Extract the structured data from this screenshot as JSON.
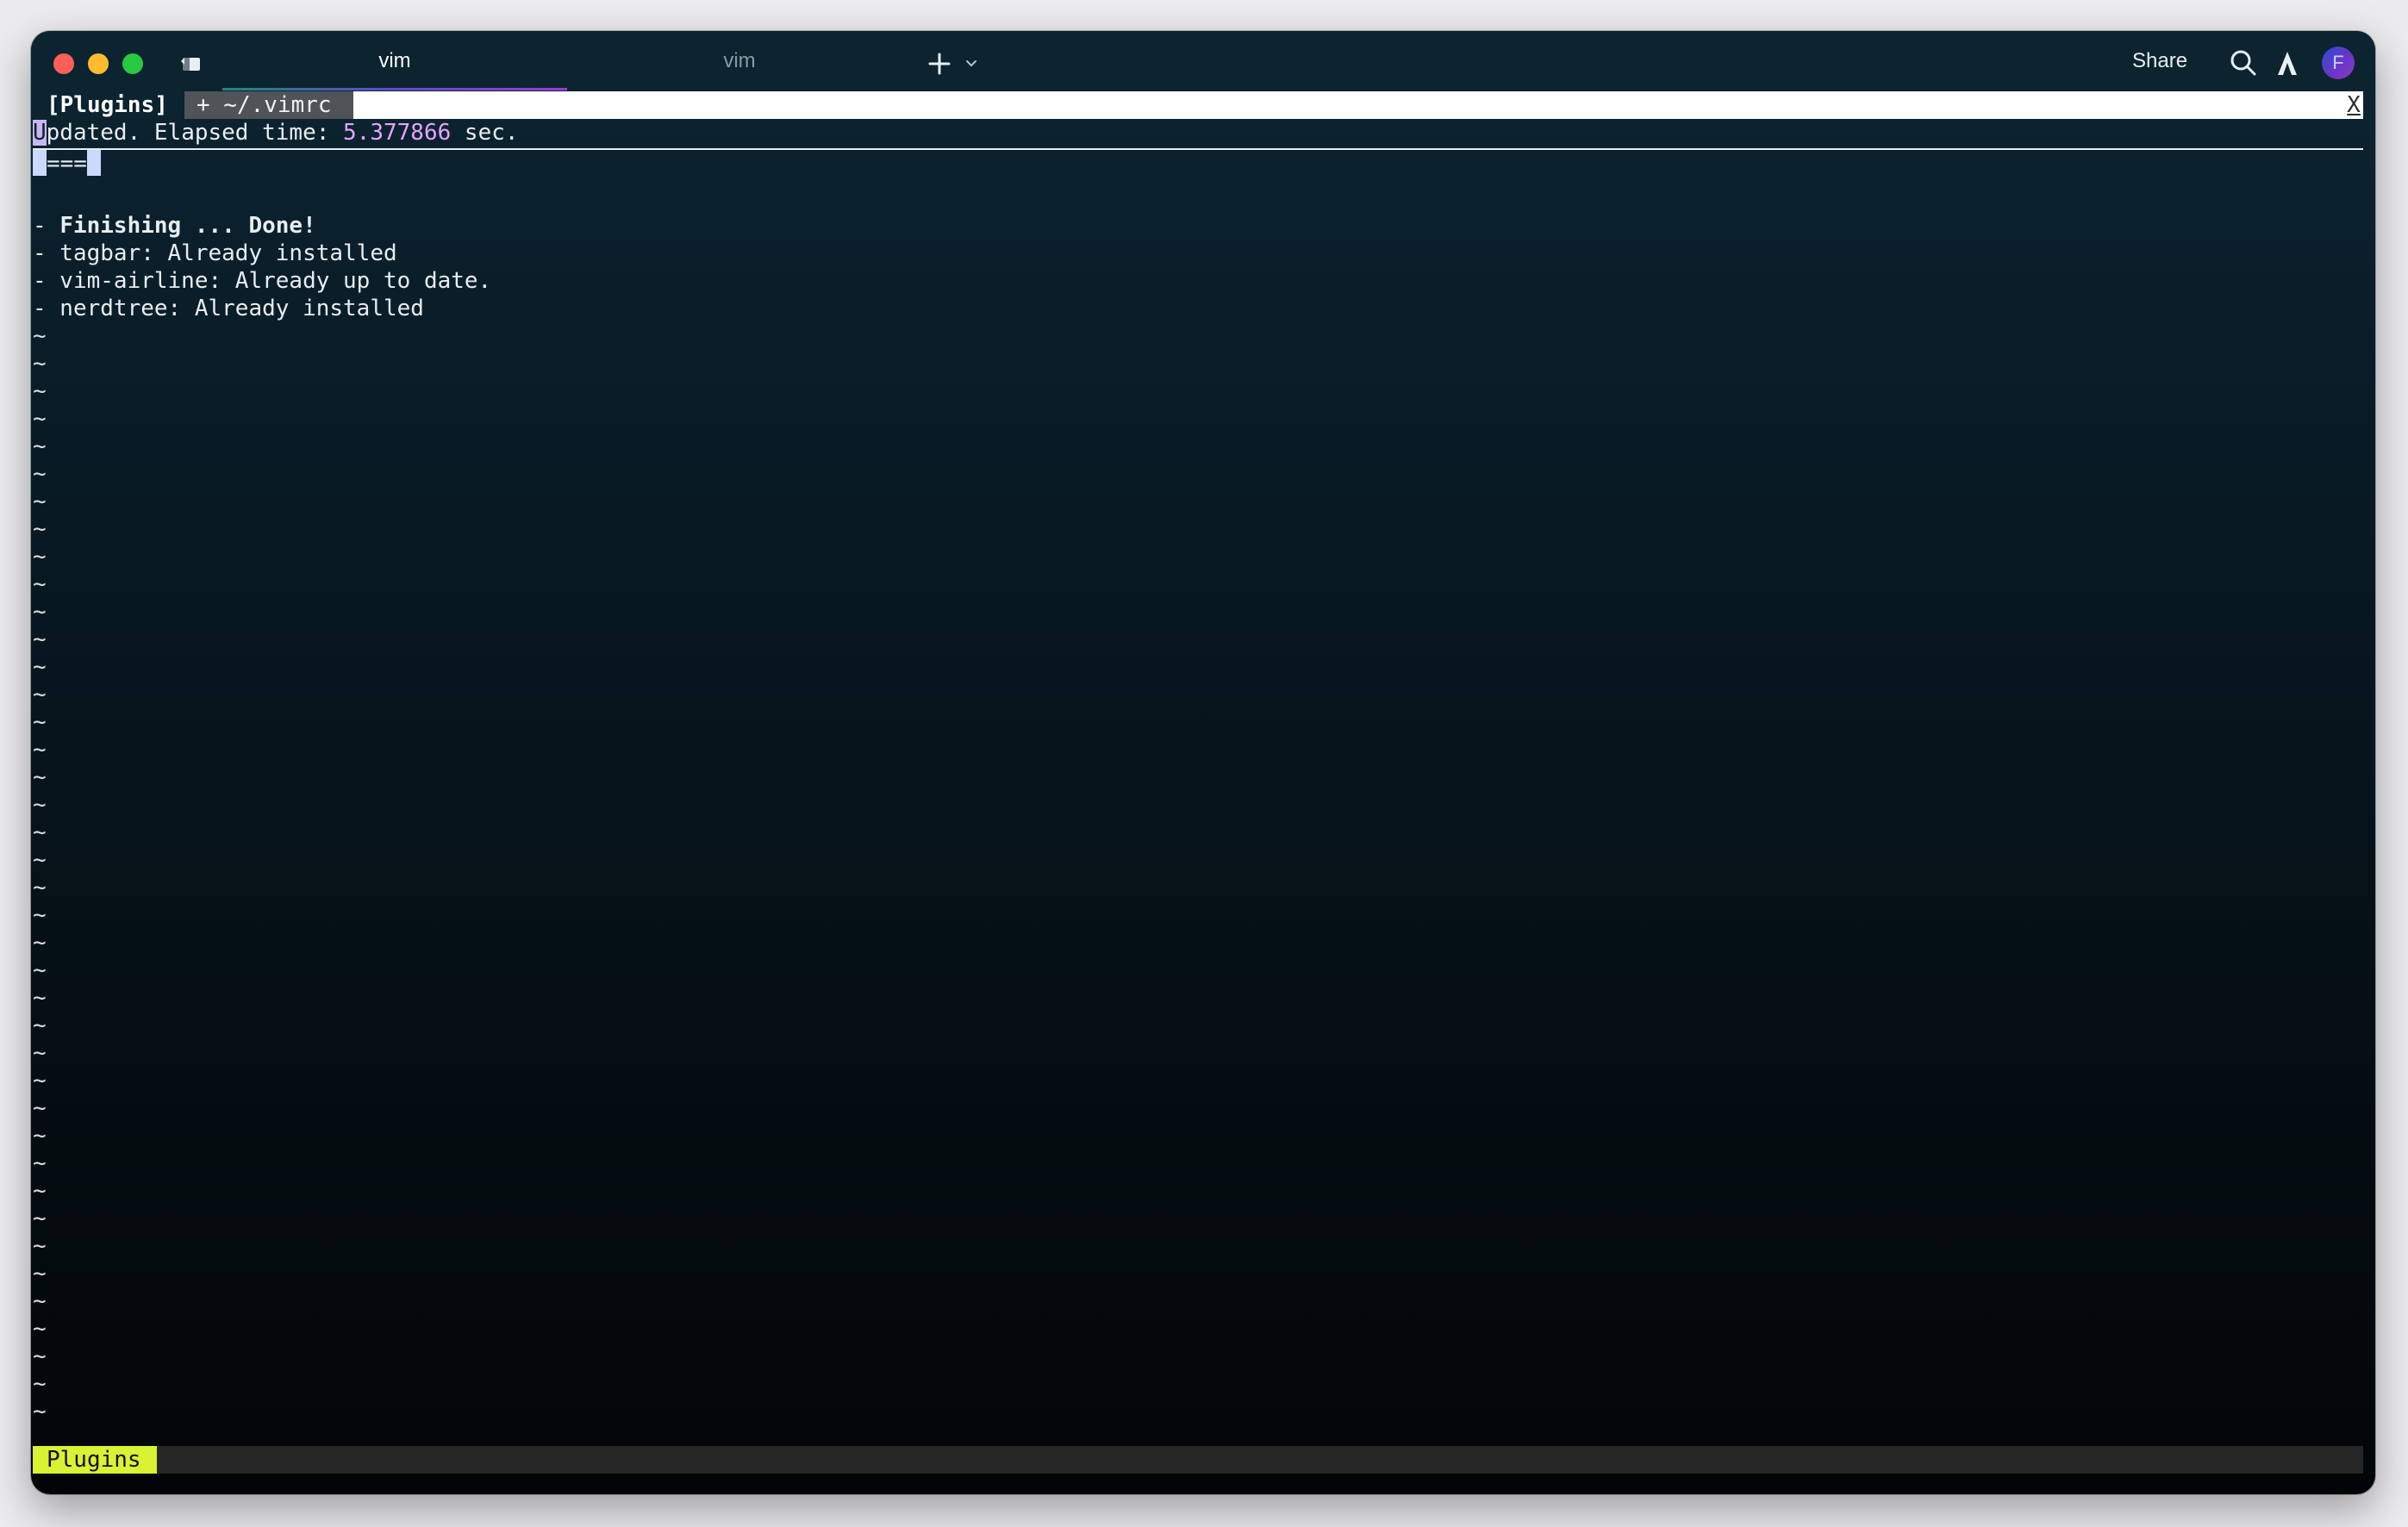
{
  "window": {
    "tabs": [
      {
        "label": "vim",
        "active": true
      },
      {
        "label": "vim",
        "active": false
      }
    ],
    "share_label": "Share",
    "avatar_initial": "F",
    "icons": {
      "sidebar": "sidebar-icon",
      "new_tab": "plus-icon",
      "new_tab_menu": "chevron-down-icon",
      "search": "search-icon",
      "ai": "ai-icon"
    },
    "colors": {
      "close": "#ff5f57",
      "minimize": "#febc2e",
      "maximize": "#28c840"
    }
  },
  "terminal": {
    "tabline": {
      "buffer_selected": "[Plugins]",
      "buffer_modified": "+ ~/.vimrc",
      "close": "X"
    },
    "status": {
      "cursor_char": "U",
      "prefix": "pdated. Elapsed time: ",
      "elapsed": "5.377866",
      "suffix": " sec."
    },
    "progress": {
      "bar": "===",
      "complete": true
    },
    "lines": [
      {
        "text": "- ",
        "bold_text": "Finishing ... Done!"
      },
      {
        "text": "- tagbar: Already installed"
      },
      {
        "text": "- vim-airline: Already up to date."
      },
      {
        "text": "- nerdtree: Already installed"
      }
    ],
    "tilde_char": "~",
    "statusline": {
      "mode": "Plugins",
      "color": "#d9f233"
    }
  }
}
